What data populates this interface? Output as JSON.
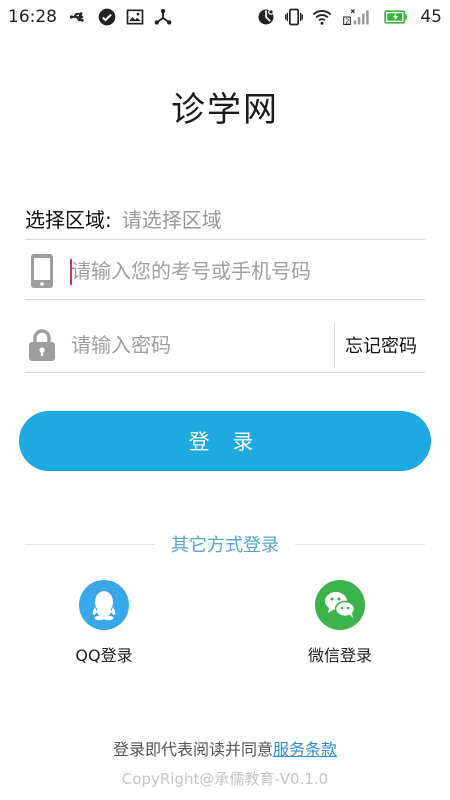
{
  "status_bar": {
    "time": "16:28",
    "battery_level": "45",
    "icons_left": [
      "usb-icon",
      "check-circle-icon",
      "image-icon",
      "share-icon"
    ],
    "icons_right": [
      "rotation-icon",
      "vibrate-icon",
      "wifi-icon",
      "sim2-signal-icon",
      "battery-charging-icon"
    ]
  },
  "header": {
    "title": "诊学网"
  },
  "region": {
    "label": "选择区域:",
    "value": "请选择区域"
  },
  "account": {
    "placeholder": "请输入您的考号或手机号码",
    "icon": "phone-icon"
  },
  "password": {
    "placeholder": "请输入密码",
    "icon": "lock-icon",
    "forgot_label": "忘记密码"
  },
  "login_button": {
    "label": "登 录"
  },
  "other_login": {
    "title": "其它方式登录",
    "qq_label": "QQ登录",
    "wechat_label": "微信登录"
  },
  "footer": {
    "agreement_text": "登录即代表阅读并同意",
    "terms_link": "服务条款",
    "copyright": "CopyRight@承儒教育-V0.1.0"
  },
  "colors": {
    "accent": "#1ea9e1",
    "qq": "#38a8e8",
    "wechat": "#3bb24a",
    "link": "#2a8fd8",
    "battery": "#3cb33c"
  }
}
